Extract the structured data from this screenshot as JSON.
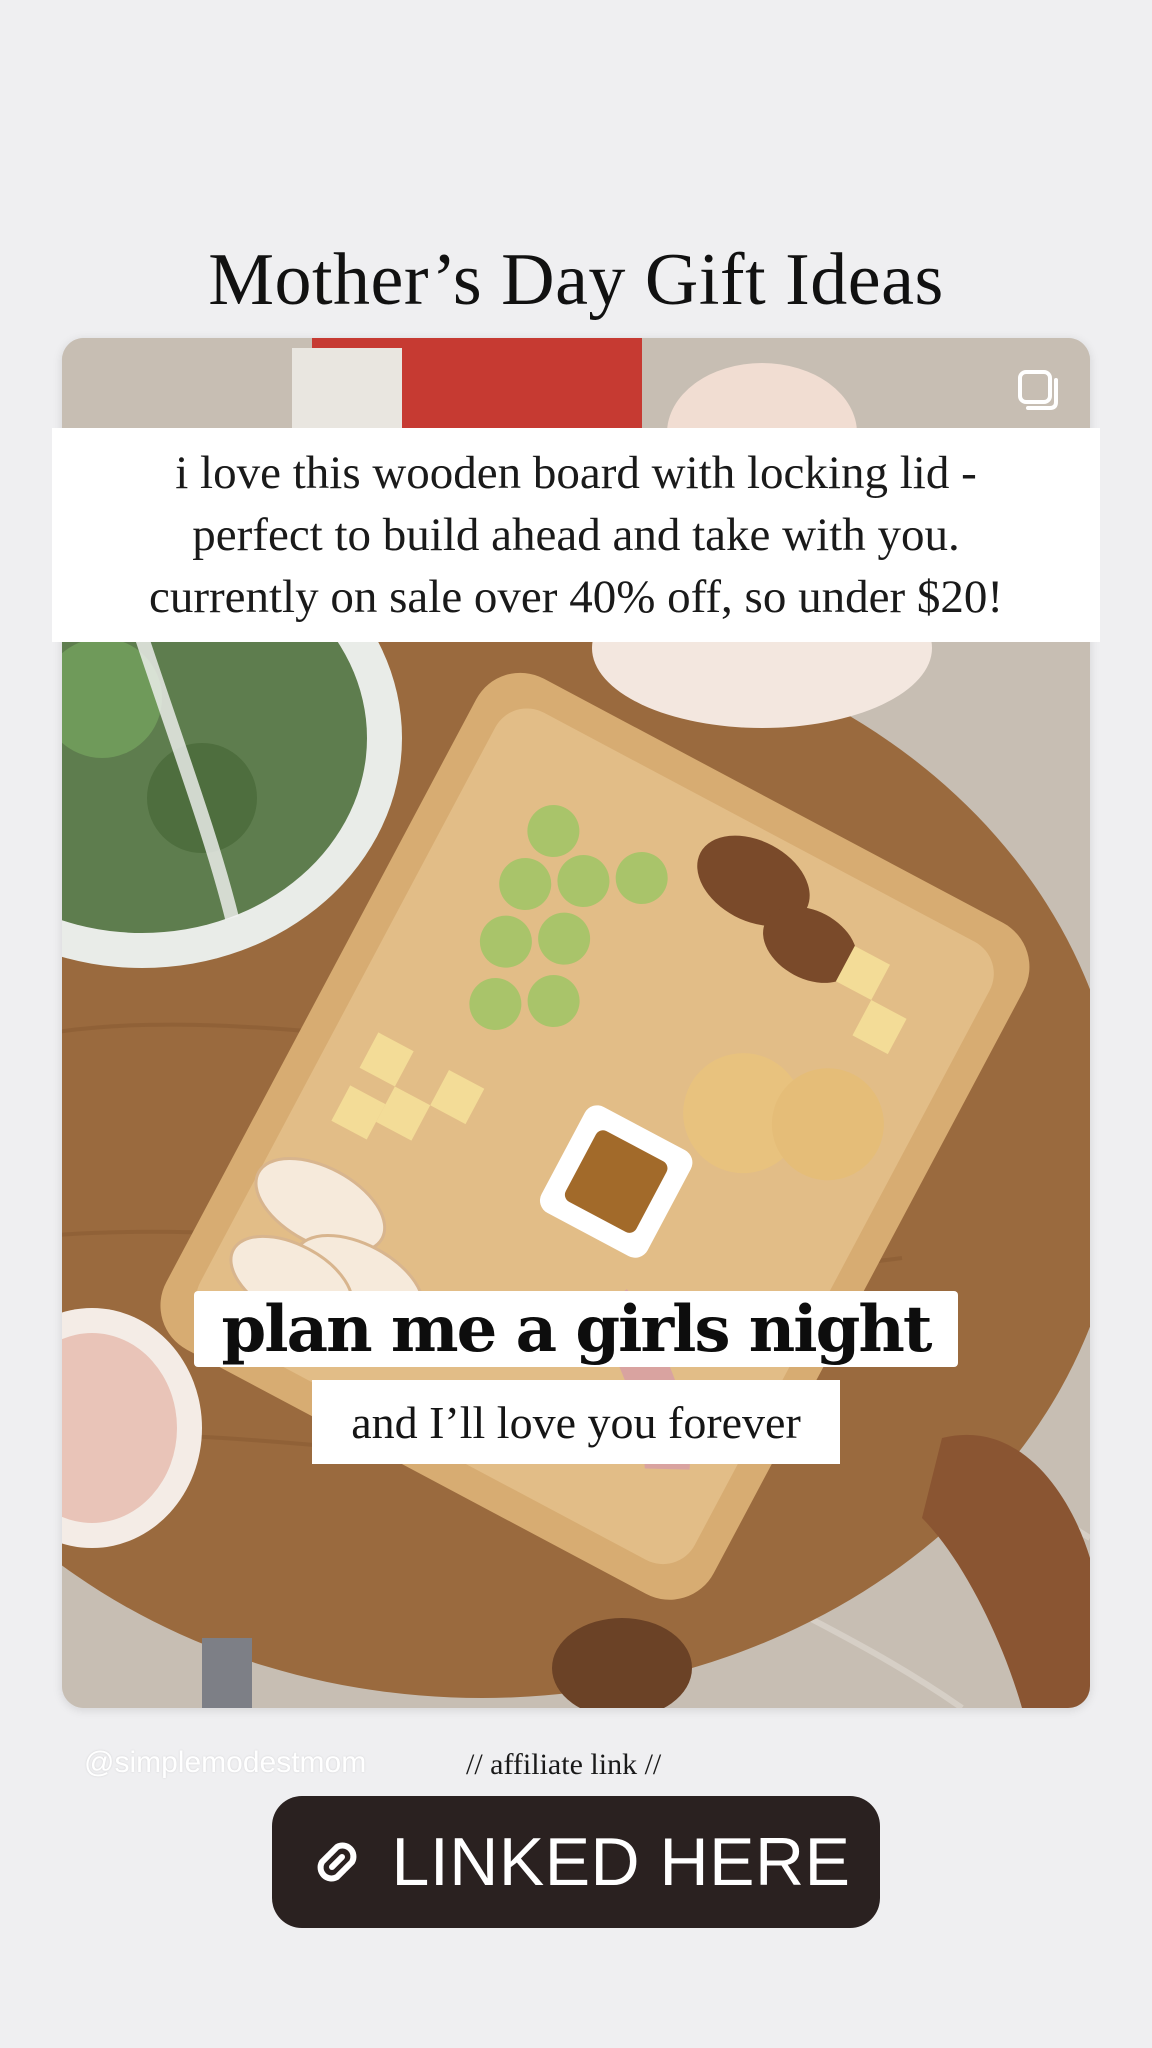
{
  "story": {
    "title": "Mother’s Day Gift Ideas",
    "caption_lines": [
      "i love this wooden board with locking lid -",
      "perfect to build ahead and take with you.",
      "currently on sale over 40% off, so under $20!"
    ],
    "headline": "plan me a girls night",
    "subhead": "and I’ll love you forever",
    "handle": "@simplemodestmom",
    "affiliate_note": "// affiliate link //",
    "link_sticker_label": "LINKED HERE"
  },
  "icons": {
    "multi_media": "multiple-images-icon",
    "link": "link-chain-icon"
  },
  "colors": {
    "background": "#efeff1",
    "sticker": "#2a2120",
    "caption_bg": "#ffffff"
  }
}
